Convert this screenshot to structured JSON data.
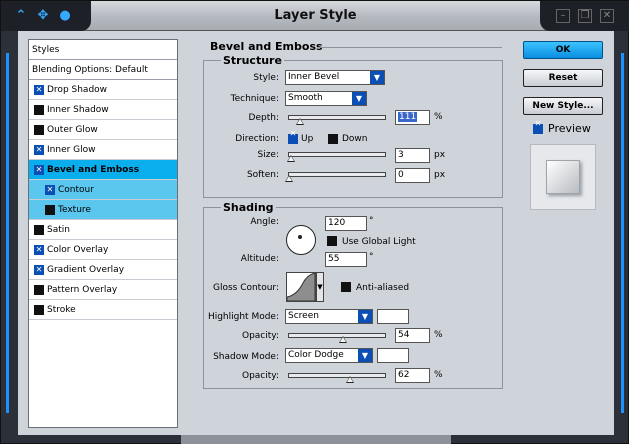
{
  "window": {
    "title": "Layer Style"
  },
  "colors": {
    "accent": "#0aaeed",
    "checkbox_on": "#0b4fb5",
    "strip": "#1e90ff"
  },
  "styles_list": {
    "header": "Styles",
    "blending": "Blending Options: Default",
    "items": [
      {
        "label": "Drop Shadow",
        "checked": true
      },
      {
        "label": "Inner Shadow",
        "checked": false
      },
      {
        "label": "Outer Glow",
        "checked": false
      },
      {
        "label": "Inner Glow",
        "checked": true
      },
      {
        "label": "Bevel and Emboss",
        "checked": true,
        "active": true
      },
      {
        "label": "Contour",
        "checked": true,
        "sub": true
      },
      {
        "label": "Texture",
        "checked": false,
        "sub": true
      },
      {
        "label": "Satin",
        "checked": false
      },
      {
        "label": "Color Overlay",
        "checked": true
      },
      {
        "label": "Gradient Overlay",
        "checked": true
      },
      {
        "label": "Pattern Overlay",
        "checked": false
      },
      {
        "label": "Stroke",
        "checked": false
      }
    ]
  },
  "bevel": {
    "title": "Bevel and Emboss",
    "structure": {
      "title": "Structure",
      "style_label": "Style:",
      "style_value": "Inner Bevel",
      "technique_label": "Technique:",
      "technique_value": "Smooth",
      "depth_label": "Depth:",
      "depth_value": "111",
      "depth_unit": "%",
      "direction_label": "Direction:",
      "up_label": "Up",
      "down_label": "Down",
      "up_selected": true,
      "size_label": "Size:",
      "size_value": "3",
      "size_unit": "px",
      "soften_label": "Soften:",
      "soften_value": "0",
      "soften_unit": "px"
    },
    "shading": {
      "title": "Shading",
      "angle_label": "Angle:",
      "angle_value": "120",
      "angle_unit": "°",
      "global_light_label": "Use Global Light",
      "altitude_label": "Altitude:",
      "altitude_value": "55",
      "altitude_unit": "°",
      "gloss_label": "Gloss Contour:",
      "antialiased_label": "Anti-aliased",
      "highlight_mode_label": "Highlight Mode:",
      "highlight_mode_value": "Screen",
      "highlight_opacity_label": "Opacity:",
      "highlight_opacity_value": "54",
      "highlight_opacity_unit": "%",
      "shadow_mode_label": "Shadow Mode:",
      "shadow_mode_value": "Color Dodge",
      "shadow_opacity_label": "Opacity:",
      "shadow_opacity_value": "62",
      "shadow_opacity_unit": "%",
      "highlight_color": "#ffffff",
      "shadow_color": "#ffffff"
    }
  },
  "buttons": {
    "ok": "OK",
    "reset": "Reset",
    "new_style": "New Style..."
  },
  "preview": {
    "label": "Preview",
    "checked": true
  }
}
